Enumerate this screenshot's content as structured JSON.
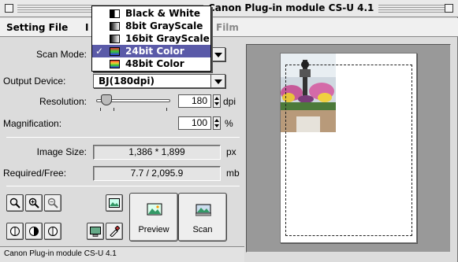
{
  "window": {
    "title": "Canon Plug-in module CS-U 4.1"
  },
  "menubar": {
    "items": [
      "Setting File",
      "I",
      "Film"
    ]
  },
  "scan_mode": {
    "label": "Scan Mode:",
    "options": [
      {
        "label": "Black & White",
        "selected": false,
        "swatch": "bw-icon"
      },
      {
        "label": "8bit GrayScale",
        "selected": false,
        "swatch": "gray8-icon"
      },
      {
        "label": "16bit GrayScale",
        "selected": false,
        "swatch": "gray16-icon"
      },
      {
        "label": "24bit Color",
        "selected": true,
        "swatch": "color24-icon"
      },
      {
        "label": "48bit Color",
        "selected": false,
        "swatch": "color48-icon"
      }
    ],
    "check_mark": "✓"
  },
  "output_device": {
    "label": "Output Device:",
    "value": "BJ(180dpi)"
  },
  "resolution": {
    "label": "Resolution:",
    "value": "180",
    "unit": "dpi"
  },
  "magnification": {
    "label": "Magnification:",
    "value": "100",
    "unit": "%"
  },
  "image_size": {
    "label": "Image Size:",
    "value": "1,386 * 1,899",
    "unit": "px"
  },
  "required_free": {
    "label": "Required/Free:",
    "value": "7.7 / 2,095.9",
    "unit": "mb"
  },
  "buttons": {
    "preview": "Preview",
    "scan": "Scan"
  },
  "status": {
    "text": "Canon Plug-in module CS-U 4.1"
  },
  "colors": {
    "selection": "#5a5aa8",
    "window_bg": "#dcdcdc",
    "preview_bg": "#999999"
  }
}
